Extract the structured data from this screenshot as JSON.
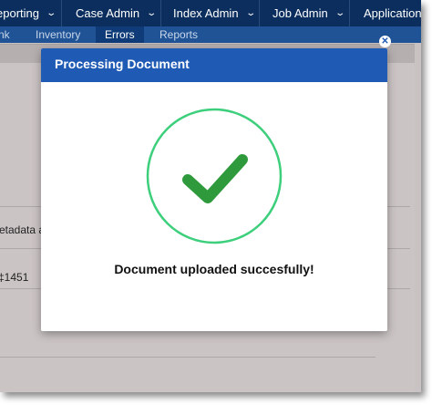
{
  "top_nav": {
    "items": [
      {
        "label": "eporting",
        "icon": "chevron-down-icon"
      },
      {
        "label": "Case Admin",
        "icon": "chevron-down-icon"
      },
      {
        "label": "Index Admin",
        "icon": "chevron-down-icon"
      },
      {
        "label": "Job Admin",
        "icon": "chevron-down-icon"
      },
      {
        "label": "Application",
        "icon": null
      }
    ]
  },
  "sub_nav": {
    "tabs": [
      {
        "label": "nk",
        "active": false
      },
      {
        "label": "Inventory",
        "active": false
      },
      {
        "label": "Errors",
        "active": true
      },
      {
        "label": "Reports",
        "active": false
      }
    ]
  },
  "background_panel": {
    "row_texts": [
      "etadata a",
      "‡1451"
    ]
  },
  "modal": {
    "title": "Processing Document",
    "close_icon": "close-icon",
    "status_icon": "check-circle-icon",
    "message": "Document uploaded succesfully!"
  },
  "colors": {
    "nav_dark": "#0b2e5e",
    "nav_sub": "#1f5396",
    "modal_header": "#1f5ab4",
    "success_ring": "#3dcf7c",
    "success_check": "#2e9a3c"
  }
}
